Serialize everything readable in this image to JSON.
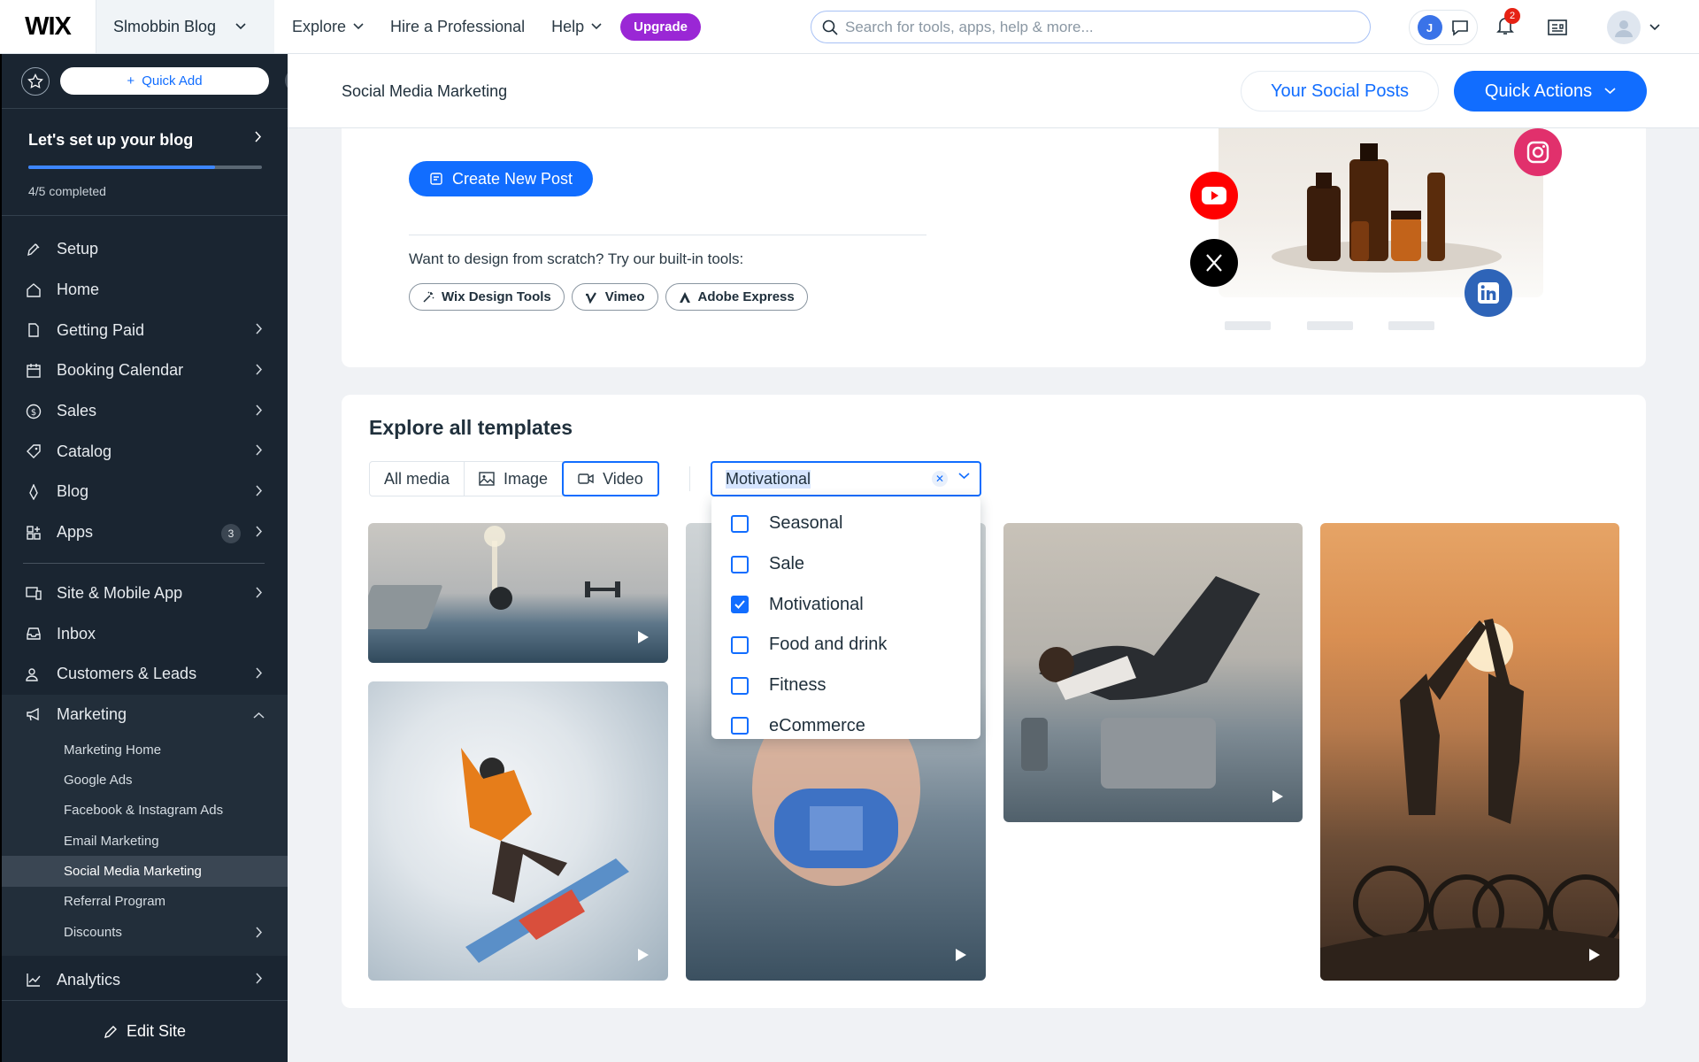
{
  "topbar": {
    "logo": "WIX",
    "site_name": "Slmobbin Blog",
    "nav": [
      {
        "label": "Explore",
        "has_menu": true
      },
      {
        "label": "Hire a Professional",
        "has_menu": false
      },
      {
        "label": "Help",
        "has_menu": true
      }
    ],
    "upgrade_label": "Upgrade",
    "search_placeholder": "Search for tools, apps, help & more...",
    "account_initial": "J",
    "notifications_count": "2"
  },
  "sidebar": {
    "quick_add_label": "Quick Add",
    "setup": {
      "title": "Let's set up your blog",
      "progress_fraction": 0.8,
      "count_text": "4/5 completed"
    },
    "items": [
      {
        "label": "Setup",
        "icon": "rocket-icon",
        "arrow": false
      },
      {
        "label": "Home",
        "icon": "home-icon",
        "arrow": false
      },
      {
        "label": "Getting Paid",
        "icon": "document-dollar-icon",
        "arrow": true
      },
      {
        "label": "Booking Calendar",
        "icon": "calendar-icon",
        "arrow": true
      },
      {
        "label": "Sales",
        "icon": "dollar-circle-icon",
        "arrow": true
      },
      {
        "label": "Catalog",
        "icon": "tag-icon",
        "arrow": true
      },
      {
        "label": "Blog",
        "icon": "pen-nib-icon",
        "arrow": true
      },
      {
        "label": "Apps",
        "icon": "apps-icon",
        "arrow": true,
        "badge": "3"
      }
    ],
    "items2": [
      {
        "label": "Site & Mobile App",
        "icon": "devices-icon",
        "arrow": true
      },
      {
        "label": "Inbox",
        "icon": "inbox-icon",
        "arrow": false
      },
      {
        "label": "Customers & Leads",
        "icon": "people-icon",
        "arrow": true
      }
    ],
    "marketing": {
      "label": "Marketing",
      "sub_items": [
        {
          "label": "Marketing Home"
        },
        {
          "label": "Google Ads"
        },
        {
          "label": "Facebook & Instagram Ads"
        },
        {
          "label": "Email Marketing"
        },
        {
          "label": "Social Media Marketing",
          "active": true
        },
        {
          "label": "Referral Program"
        },
        {
          "label": "Discounts",
          "arrow": true
        }
      ]
    },
    "analytics_label": "Analytics",
    "edit_site_label": "Edit Site"
  },
  "header": {
    "title": "Social Media Marketing",
    "your_posts_label": "Your Social Posts",
    "quick_actions_label": "Quick Actions"
  },
  "promo": {
    "create_label": "Create New Post",
    "design_text": "Want to design from scratch? Try our built-in tools:",
    "tools": [
      {
        "label": "Wix Design Tools",
        "icon": "magic-wand-icon"
      },
      {
        "label": "Vimeo",
        "icon": "vimeo-icon"
      },
      {
        "label": "Adobe Express",
        "icon": "adobe-express-icon"
      }
    ],
    "colors": {
      "youtube": "#ff0000",
      "x": "#000000",
      "linkedin": "#0a66c2",
      "instagram": "#e1306c"
    }
  },
  "templates": {
    "title": "Explore all templates",
    "media_filters": [
      {
        "label": "All media",
        "icon": ""
      },
      {
        "label": "Image",
        "icon": "image-icon"
      },
      {
        "label": "Video",
        "icon": "video-icon",
        "active": true
      }
    ],
    "category_value": "Motivational",
    "category_options": [
      {
        "label": "Seasonal",
        "checked": false
      },
      {
        "label": "Sale",
        "checked": false
      },
      {
        "label": "Motivational",
        "checked": true
      },
      {
        "label": "Food and drink",
        "checked": false
      },
      {
        "label": "Fitness",
        "checked": false
      },
      {
        "label": "eCommerce",
        "checked": false
      }
    ],
    "video_thumbnails": [
      {
        "name": "home-gym-video"
      },
      {
        "name": "snowboarder-video"
      },
      {
        "name": "dumbbell-video"
      },
      {
        "name": "situps-video"
      },
      {
        "name": "cyclists-high-five-video"
      }
    ]
  },
  "colors": {
    "accent": "#116dff",
    "sidebar_bg": "#1a2531",
    "upgrade": "#9a27d5"
  }
}
